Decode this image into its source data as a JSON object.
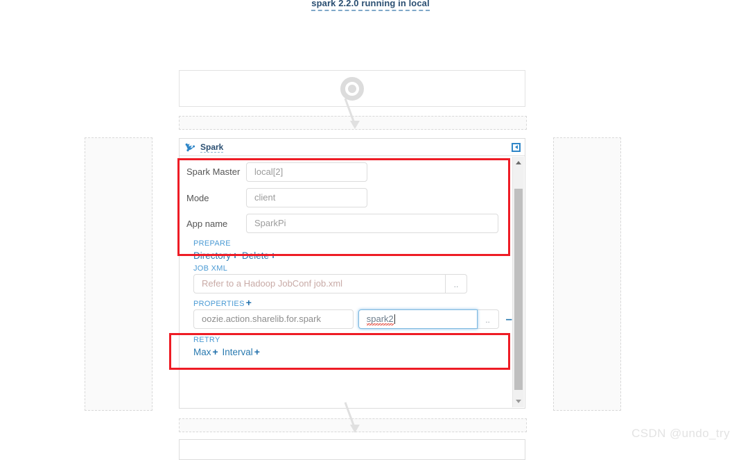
{
  "page": {
    "title": "spark 2.2.0 running in local",
    "watermark": "CSDN @undo_try"
  },
  "start_node": {
    "icon": "record-target-icon"
  },
  "spark_node": {
    "title": "Spark",
    "icon": "spark-star-icon",
    "collapse_icon": "collapse-left-arrow-icon",
    "form": {
      "master": {
        "label": "Spark Master",
        "value": "local[2]"
      },
      "mode": {
        "label": "Mode",
        "value": "client"
      },
      "appname": {
        "label": "App name",
        "value": "SparkPi"
      }
    },
    "prepare": {
      "section_label": "PREPARE",
      "directory_label": "Directory",
      "delete_label": "Delete",
      "add_glyph": "+"
    },
    "job_xml": {
      "section_label": "JOB XML",
      "placeholder": "Refer to a Hadoop JobConf job.xml",
      "browse_label": ".."
    },
    "properties": {
      "section_label": "PROPERTIES",
      "add_glyph": "+",
      "rows": [
        {
          "name": "oozie.action.sharelib.for.spark",
          "value": "spark2",
          "browse_label": "..",
          "remove_glyph": "–"
        }
      ]
    },
    "retry": {
      "section_label": "RETRY",
      "max_label": "Max",
      "interval_label": "Interval",
      "add_glyph": "+"
    },
    "scrollbar": {
      "up_glyph": "up-arrow-icon",
      "down_glyph": "down-arrow-icon"
    }
  },
  "colors": {
    "link_blue": "#2a7ab0",
    "section_blue": "#4a9ad4",
    "annotation_red": "#ee1c25",
    "focus_blue": "#7cb8e0"
  }
}
